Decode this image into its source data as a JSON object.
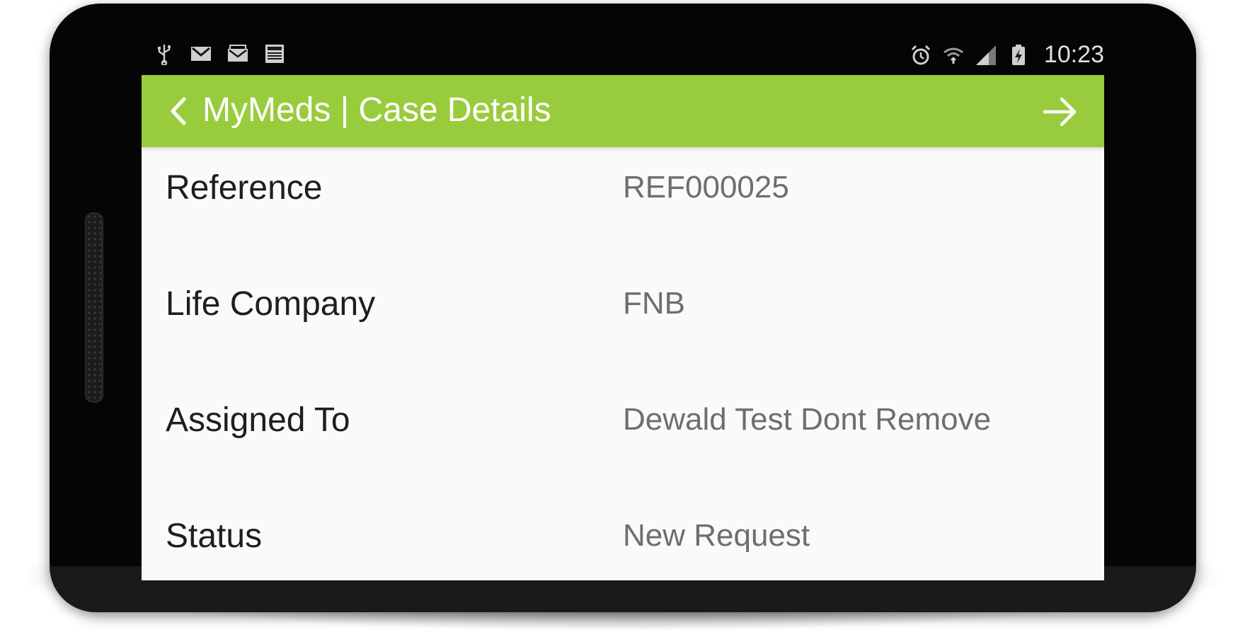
{
  "status_bar": {
    "left_icons": [
      "usb-icon",
      "gmail-icon",
      "email-icon",
      "news-icon"
    ],
    "right_icons": [
      "alarm-icon",
      "wifi-icon",
      "signal-icon",
      "battery-icon"
    ],
    "time": "10:23"
  },
  "action_bar": {
    "title": "MyMeds | Case Details",
    "back_icon": "chevron-left-icon",
    "next_icon": "arrow-right-icon",
    "color": "#99cc3d"
  },
  "details": [
    {
      "label": "Reference",
      "value": "REF000025"
    },
    {
      "label": "Life Company",
      "value": "FNB"
    },
    {
      "label": "Assigned To",
      "value": "Dewald Test Dont Remove"
    },
    {
      "label": "Status",
      "value": "New Request"
    }
  ]
}
